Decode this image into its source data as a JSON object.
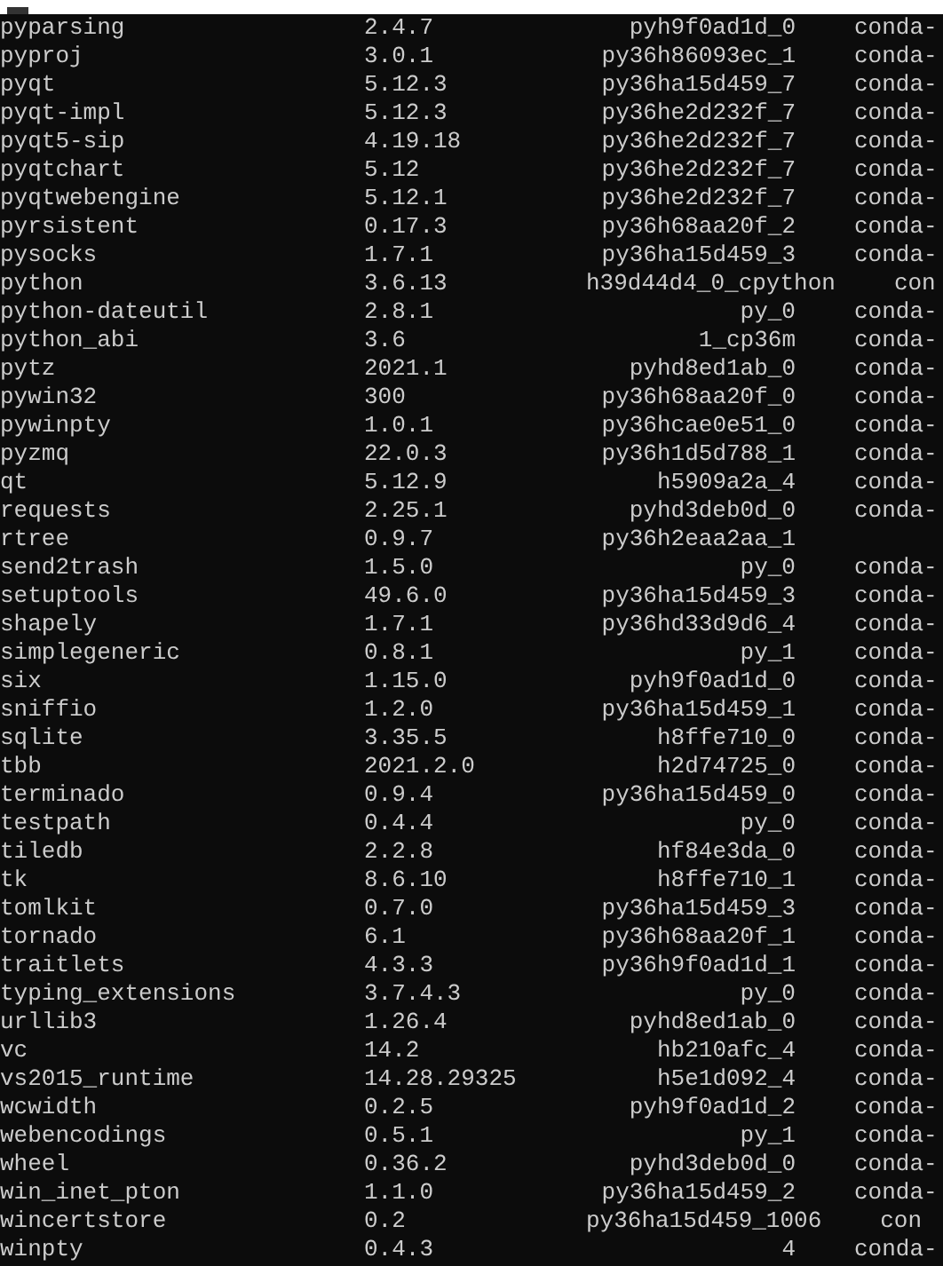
{
  "packages": [
    {
      "name": "pyparsing",
      "version": "2.4.7",
      "build": "pyh9f0ad1d_0",
      "channel": "conda-"
    },
    {
      "name": "pyproj",
      "version": "3.0.1",
      "build": "py36h86093ec_1",
      "channel": "conda-"
    },
    {
      "name": "pyqt",
      "version": "5.12.3",
      "build": "py36ha15d459_7",
      "channel": "conda-"
    },
    {
      "name": "pyqt-impl",
      "version": "5.12.3",
      "build": "py36he2d232f_7",
      "channel": "conda-"
    },
    {
      "name": "pyqt5-sip",
      "version": "4.19.18",
      "build": "py36he2d232f_7",
      "channel": "conda-"
    },
    {
      "name": "pyqtchart",
      "version": "5.12",
      "build": "py36he2d232f_7",
      "channel": "conda-"
    },
    {
      "name": "pyqtwebengine",
      "version": "5.12.1",
      "build": "py36he2d232f_7",
      "channel": "conda-"
    },
    {
      "name": "pyrsistent",
      "version": "0.17.3",
      "build": "py36h68aa20f_2",
      "channel": "conda-"
    },
    {
      "name": "pysocks",
      "version": "1.7.1",
      "build": "py36ha15d459_3",
      "channel": "conda-"
    },
    {
      "name": "python",
      "version": "3.6.13",
      "build": "h39d44d4_0_cpython",
      "channel": "con"
    },
    {
      "name": "python-dateutil",
      "version": "2.8.1",
      "build": "py_0",
      "channel": "conda-"
    },
    {
      "name": "python_abi",
      "version": "3.6",
      "build": "1_cp36m",
      "channel": "conda-"
    },
    {
      "name": "pytz",
      "version": "2021.1",
      "build": "pyhd8ed1ab_0",
      "channel": "conda-"
    },
    {
      "name": "pywin32",
      "version": "300",
      "build": "py36h68aa20f_0",
      "channel": "conda-"
    },
    {
      "name": "pywinpty",
      "version": "1.0.1",
      "build": "py36hcae0e51_0",
      "channel": "conda-"
    },
    {
      "name": "pyzmq",
      "version": "22.0.3",
      "build": "py36h1d5d788_1",
      "channel": "conda-"
    },
    {
      "name": "qt",
      "version": "5.12.9",
      "build": "h5909a2a_4",
      "channel": "conda-"
    },
    {
      "name": "requests",
      "version": "2.25.1",
      "build": "pyhd3deb0d_0",
      "channel": "conda-"
    },
    {
      "name": "rtree",
      "version": "0.9.7",
      "build": "py36h2eaa2aa_1"
    },
    {
      "name": "send2trash",
      "version": "1.5.0",
      "build": "py_0",
      "channel": "conda-"
    },
    {
      "name": "setuptools",
      "version": "49.6.0",
      "build": "py36ha15d459_3",
      "channel": "conda-"
    },
    {
      "name": "shapely",
      "version": "1.7.1",
      "build": "py36hd33d9d6_4",
      "channel": "conda-"
    },
    {
      "name": "simplegeneric",
      "version": "0.8.1",
      "build": "py_1",
      "channel": "conda-"
    },
    {
      "name": "six",
      "version": "1.15.0",
      "build": "pyh9f0ad1d_0",
      "channel": "conda-"
    },
    {
      "name": "sniffio",
      "version": "1.2.0",
      "build": "py36ha15d459_1",
      "channel": "conda-"
    },
    {
      "name": "sqlite",
      "version": "3.35.5",
      "build": "h8ffe710_0",
      "channel": "conda-"
    },
    {
      "name": "tbb",
      "version": "2021.2.0",
      "build": "h2d74725_0",
      "channel": "conda-"
    },
    {
      "name": "terminado",
      "version": "0.9.4",
      "build": "py36ha15d459_0",
      "channel": "conda-"
    },
    {
      "name": "testpath",
      "version": "0.4.4",
      "build": "py_0",
      "channel": "conda-"
    },
    {
      "name": "tiledb",
      "version": "2.2.8",
      "build": "hf84e3da_0",
      "channel": "conda-"
    },
    {
      "name": "tk",
      "version": "8.6.10",
      "build": "h8ffe710_1",
      "channel": "conda-"
    },
    {
      "name": "tomlkit",
      "version": "0.7.0",
      "build": "py36ha15d459_3",
      "channel": "conda-"
    },
    {
      "name": "tornado",
      "version": "6.1",
      "build": "py36h68aa20f_1",
      "channel": "conda-"
    },
    {
      "name": "traitlets",
      "version": "4.3.3",
      "build": "py36h9f0ad1d_1",
      "channel": "conda-"
    },
    {
      "name": "typing_extensions",
      "version": "3.7.4.3",
      "build": "py_0",
      "channel": "conda-"
    },
    {
      "name": "urllib3",
      "version": "1.26.4",
      "build": "pyhd8ed1ab_0",
      "channel": "conda-"
    },
    {
      "name": "vc",
      "version": "14.2",
      "build": "hb210afc_4",
      "channel": "conda-"
    },
    {
      "name": "vs2015_runtime",
      "version": "14.28.29325",
      "build": "h5e1d092_4",
      "channel": "conda-"
    },
    {
      "name": "wcwidth",
      "version": "0.2.5",
      "build": "pyh9f0ad1d_2",
      "channel": "conda-"
    },
    {
      "name": "webencodings",
      "version": "0.5.1",
      "build": "py_1",
      "channel": "conda-"
    },
    {
      "name": "wheel",
      "version": "0.36.2",
      "build": "pyhd3deb0d_0",
      "channel": "conda-"
    },
    {
      "name": "win_inet_pton",
      "version": "1.1.0",
      "build": "py36ha15d459_2",
      "channel": "conda-"
    },
    {
      "name": "wincertstore",
      "version": "0.2",
      "build": "py36ha15d459_1006",
      "channel": "con"
    },
    {
      "name": "winpty",
      "version": "0.4.3",
      "build": "4",
      "channel": "conda-"
    }
  ]
}
